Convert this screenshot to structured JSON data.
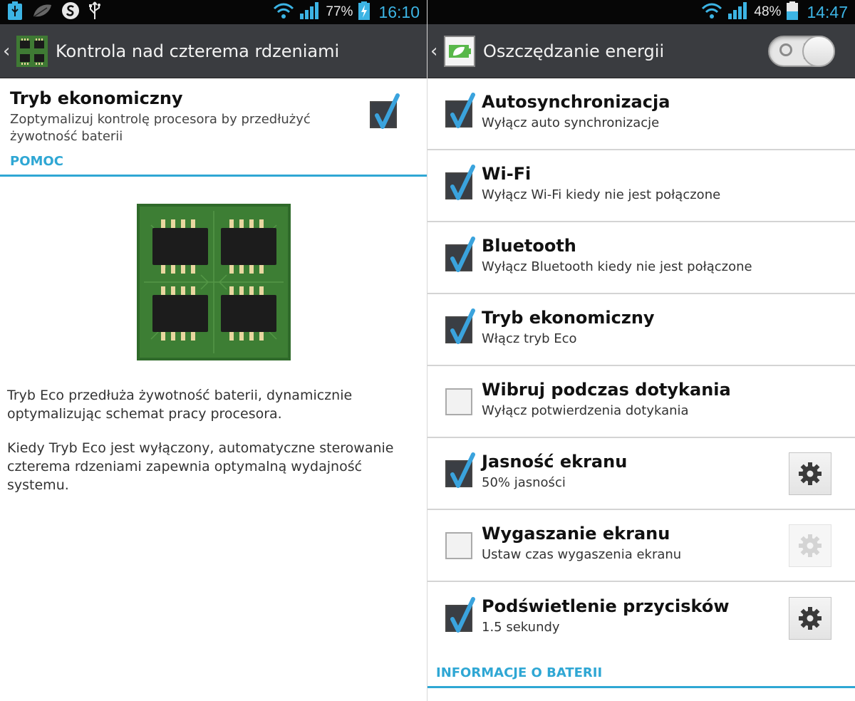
{
  "left": {
    "status_bar": {
      "battery_percent": "77%",
      "clock": "16:10"
    },
    "header": {
      "title": "Kontrola nad czterema rdzeniami"
    },
    "eco_setting": {
      "title": "Tryb ekonomiczny",
      "subtitle": "Zoptymalizuj kontrolę procesora by przedłużyć żywotność baterii",
      "checked": true
    },
    "section": "POMOC",
    "help_text": [
      "Tryb Eco przedłuża żywotność baterii, dynamicznie optymalizując schemat pracy procesora.",
      "Kiedy Tryb Eco jest wyłączony, automatyczne sterowanie czterema rdzeniami zapewnia optymalną wydajność systemu."
    ]
  },
  "right": {
    "status_bar": {
      "battery_percent": "48%",
      "clock": "14:47"
    },
    "header": {
      "title": "Oszczędzanie energii",
      "toggle_on": false
    },
    "items": [
      {
        "title": "Autosynchronizacja",
        "subtitle": "Wyłącz auto synchronizacje",
        "checked": true,
        "gear": "none"
      },
      {
        "title": "Wi-Fi",
        "subtitle": "Wyłącz Wi-Fi kiedy nie jest połączone",
        "checked": true,
        "gear": "none"
      },
      {
        "title": "Bluetooth",
        "subtitle": "Wyłącz Bluetooth kiedy nie jest połączone",
        "checked": true,
        "gear": "none"
      },
      {
        "title": "Tryb ekonomiczny",
        "subtitle": "Włącz tryb Eco",
        "checked": true,
        "gear": "none"
      },
      {
        "title": "Wibruj podczas dotykania",
        "subtitle": "Wyłącz potwierdzenia dotykania",
        "checked": false,
        "gear": "none"
      },
      {
        "title": "Jasność ekranu",
        "subtitle": "50% jasności",
        "checked": true,
        "gear": "enabled"
      },
      {
        "title": "Wygaszanie ekranu",
        "subtitle": "Ustaw czas wygaszenia ekranu",
        "checked": false,
        "gear": "disabled"
      },
      {
        "title": "Podświetlenie przycisków",
        "subtitle": "1.5 sekundy",
        "checked": true,
        "gear": "enabled"
      }
    ],
    "section": "INFORMACJE O BATERII"
  },
  "colors": {
    "accent": "#2fa7d4",
    "check": "#3aa3dd",
    "actionbar": "#3a3c40"
  },
  "icons": [
    "usb-icon",
    "leaf-icon",
    "s-icon",
    "wifi-icon",
    "signal-icon",
    "battery-icon",
    "back-chevron-icon",
    "quad-core-icon",
    "power-saving-icon",
    "checkmark-icon",
    "gear-icon"
  ]
}
